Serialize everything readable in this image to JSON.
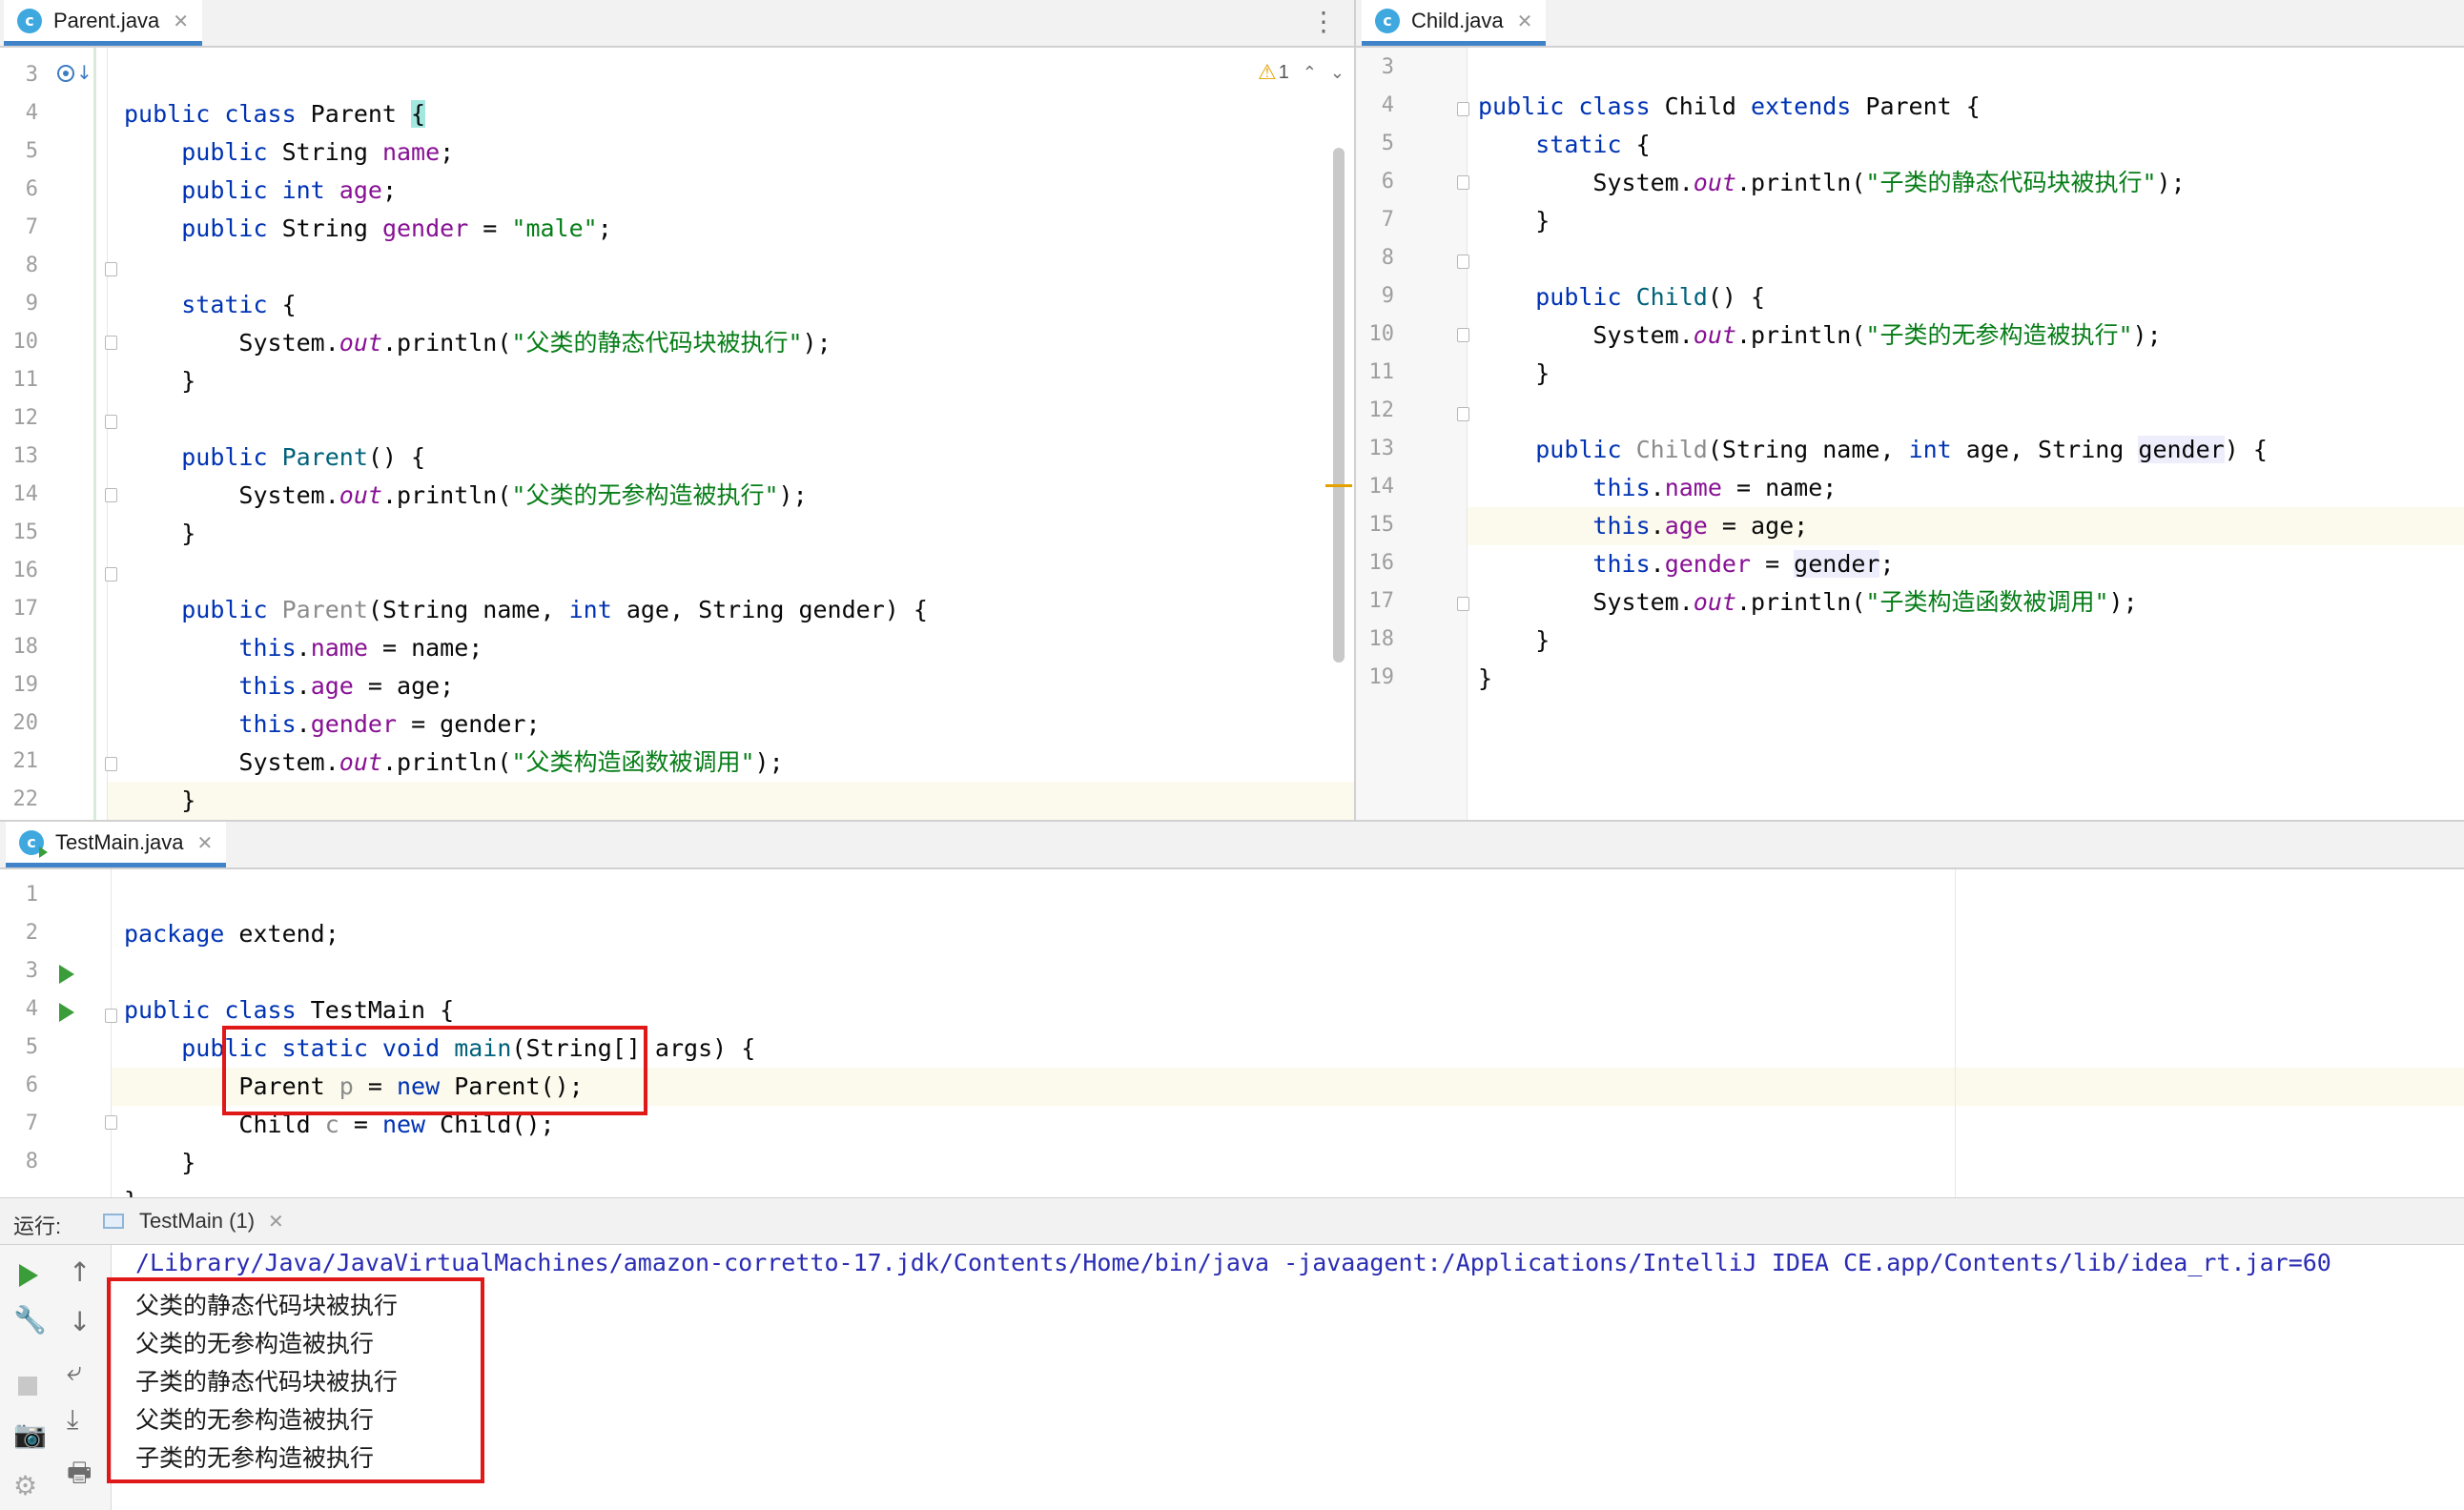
{
  "parent_editor": {
    "tab_label": "Parent.java",
    "warning_count": "1",
    "lines": [
      {
        "n": "3"
      },
      {
        "n": "4"
      },
      {
        "n": "5"
      },
      {
        "n": "6"
      },
      {
        "n": "7"
      },
      {
        "n": "8"
      },
      {
        "n": "9"
      },
      {
        "n": "10"
      },
      {
        "n": "11"
      },
      {
        "n": "12"
      },
      {
        "n": "13"
      },
      {
        "n": "14"
      },
      {
        "n": "15"
      },
      {
        "n": "16"
      },
      {
        "n": "17"
      },
      {
        "n": "18"
      },
      {
        "n": "19"
      },
      {
        "n": "20"
      },
      {
        "n": "21"
      },
      {
        "n": "22"
      }
    ],
    "code": {
      "l3_a": "public class ",
      "l3_b": "Parent ",
      "l3_c": "{",
      "l4_a": "public ",
      "l4_b": "String ",
      "l4_c": "name",
      "l4_d": ";",
      "l5_a": "public int ",
      "l5_b": "age",
      "l5_c": ";",
      "l6_a": "public ",
      "l6_b": "String ",
      "l6_c": "gender",
      "l6_d": " = ",
      "l6_e": "\"male\"",
      "l6_f": ";",
      "l8_a": "static ",
      "l8_b": "{",
      "l9_a": "System.",
      "l9_b": "out",
      "l9_c": ".println(",
      "l9_d": "\"父类的静态代码块被执行\"",
      "l9_e": ");",
      "l10": "}",
      "l12_a": "public ",
      "l12_b": "Parent",
      "l12_c": "() {",
      "l13_a": "System.",
      "l13_b": "out",
      "l13_c": ".println(",
      "l13_d": "\"父类的无参构造被执行\"",
      "l13_e": ");",
      "l14": "}",
      "l16_a": "public ",
      "l16_b": "Parent",
      "l16_c": "(String name, ",
      "l16_d": "int ",
      "l16_e": "age, String gender) {",
      "l17_a": "this",
      "l17_b": ".",
      "l17_c": "name",
      "l17_d": " = name;",
      "l18_a": "this",
      "l18_b": ".",
      "l18_c": "age",
      "l18_d": " = age;",
      "l19_a": "this",
      "l19_b": ".",
      "l19_c": "gender",
      "l19_d": " = gender;",
      "l20_a": "System.",
      "l20_b": "out",
      "l20_c": ".println(",
      "l20_d": "\"父类构造函数被调用\"",
      "l20_e": ");",
      "l21": "}",
      "l22": "}"
    }
  },
  "child_editor": {
    "tab_label": "Child.java",
    "lines": [
      {
        "n": "3"
      },
      {
        "n": "4"
      },
      {
        "n": "5"
      },
      {
        "n": "6"
      },
      {
        "n": "7"
      },
      {
        "n": "8"
      },
      {
        "n": "9"
      },
      {
        "n": "10"
      },
      {
        "n": "11"
      },
      {
        "n": "12"
      },
      {
        "n": "13"
      },
      {
        "n": "14"
      },
      {
        "n": "15"
      },
      {
        "n": "16"
      },
      {
        "n": "17"
      },
      {
        "n": "18"
      },
      {
        "n": "19"
      }
    ],
    "code": {
      "l3_a": "public class ",
      "l3_b": "Child ",
      "l3_c": "extends ",
      "l3_d": "Parent {",
      "l4_a": "static ",
      "l4_b": "{",
      "l5_a": "System.",
      "l5_b": "out",
      "l5_c": ".println(",
      "l5_d": "\"子类的静态代码块被执行\"",
      "l5_e": ");",
      "l6": "}",
      "l8_a": "public ",
      "l8_b": "Child",
      "l8_c": "() {",
      "l9_a": "System.",
      "l9_b": "out",
      "l9_c": ".println(",
      "l9_d": "\"子类的无参构造被执行\"",
      "l9_e": ");",
      "l10": "}",
      "l12_a": "public ",
      "l12_b": "Child",
      "l12_c": "(String name, ",
      "l12_d": "int ",
      "l12_e": "age, String ",
      "l12_f": "gender",
      "l12_g": ") {",
      "l13_a": "this",
      "l13_b": ".",
      "l13_c": "name",
      "l13_d": " = name;",
      "l14_a": "this",
      "l14_b": ".",
      "l14_c": "age",
      "l14_d": " = age;",
      "l15_a": "this",
      "l15_b": ".",
      "l15_c": "gender",
      "l15_d": " = ",
      "l15_e": "gender",
      "l15_f": ";",
      "l16_a": "System.",
      "l16_b": "out",
      "l16_c": ".println(",
      "l16_d": "\"子类构造函数被调用\"",
      "l16_e": ");",
      "l17": "}",
      "l18": "}"
    }
  },
  "testmain_editor": {
    "tab_label": "TestMain.java",
    "lines": [
      {
        "n": "1"
      },
      {
        "n": "2"
      },
      {
        "n": "3"
      },
      {
        "n": "4"
      },
      {
        "n": "5"
      },
      {
        "n": "6"
      },
      {
        "n": "7"
      },
      {
        "n": "8"
      }
    ],
    "code": {
      "l1_a": "package ",
      "l1_b": "extend;",
      "l3_a": "public class ",
      "l3_b": "TestMain {",
      "l4_a": "public static void ",
      "l4_b": "main",
      "l4_c": "(String[] args) {",
      "l5_a": "Parent ",
      "l5_b": "p",
      "l5_c": " = ",
      "l5_d": "new ",
      "l5_e": "Parent();",
      "l6_a": "Child ",
      "l6_b": "c",
      "l6_c": " = ",
      "l6_d": "new ",
      "l6_e": "Child();",
      "l7": "}",
      "l8": "}"
    }
  },
  "run_panel": {
    "label": "运行:",
    "tab_label": "TestMain (1)",
    "command_line": "/Library/Java/JavaVirtualMachines/amazon-corretto-17.jdk/Contents/Home/bin/java -javaagent:/Applications/IntelliJ IDEA CE.app/Contents/lib/idea_rt.jar=60",
    "output": [
      "父类的静态代码块被执行",
      "父类的无参构造被执行",
      "子类的静态代码块被执行",
      "父类的无参构造被执行",
      "子类的无参构造被执行"
    ]
  },
  "colors": {
    "keyword": "#0033b3",
    "string": "#067d17",
    "field": "#871094",
    "highlight_box": "#e01818",
    "tab_underline": "#4083c9"
  }
}
